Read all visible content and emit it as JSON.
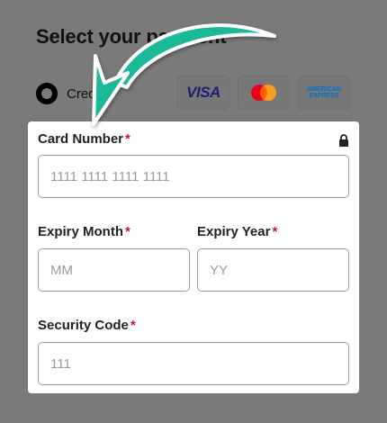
{
  "background": {
    "title": "Select your payment",
    "option_label": "Credit"
  },
  "card_logos": {
    "visa": "VISA",
    "mastercard": "mastercard-logo",
    "amex_line1": "AMERICAN",
    "amex_line2": "EXPRESS"
  },
  "form": {
    "card_number": {
      "label": "Card Number",
      "required_mark": "*",
      "placeholder": "1111 1111 1111 1111"
    },
    "expiry_month": {
      "label": "Expiry Month",
      "required_mark": "*",
      "placeholder": "MM"
    },
    "expiry_year": {
      "label": "Expiry Year",
      "required_mark": "*",
      "placeholder": "YY"
    },
    "security_code": {
      "label": "Security Code",
      "required_mark": "*",
      "placeholder": "111"
    }
  },
  "icons": {
    "lock": "lock-icon",
    "arrow": "arrow-annotation"
  },
  "colors": {
    "overlay": "#7a7a7a",
    "required": "#c8102e",
    "arrow": "#1fb89a"
  }
}
